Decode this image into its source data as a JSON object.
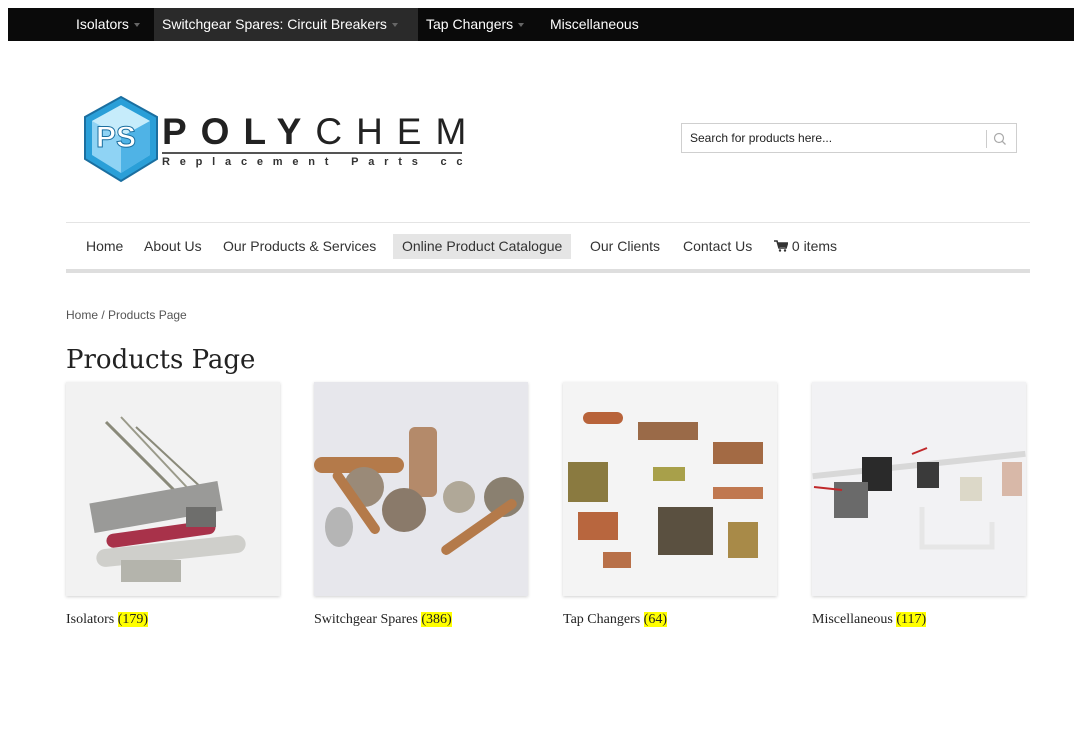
{
  "topbar": {
    "items": [
      {
        "label": "Isolators",
        "has_caret": true
      },
      {
        "label": "Switchgear Spares: Circuit Breakers",
        "has_caret": true
      },
      {
        "label": "Tap Changers",
        "has_caret": true
      },
      {
        "label": "Miscellaneous",
        "has_caret": false
      }
    ]
  },
  "logo": {
    "word_bold": "POLY",
    "word_thin": "CHEM",
    "subtitle": "Replacement Parts cc"
  },
  "search": {
    "placeholder": "Search for products here...",
    "icon": "search-icon"
  },
  "nav": {
    "items": [
      {
        "label": "Home"
      },
      {
        "label": "About Us"
      },
      {
        "label": "Our Products & Services"
      },
      {
        "label": "Online Product Catalogue",
        "active": true
      },
      {
        "label": "Our Clients"
      },
      {
        "label": "Contact Us"
      }
    ],
    "cart": {
      "icon": "cart-icon",
      "label": "0 items"
    }
  },
  "breadcrumb": "Home / Products Page",
  "page_title": "Products Page",
  "products": [
    {
      "name": "Isolators",
      "count": "(179)"
    },
    {
      "name": "Switchgear Spares",
      "count": "(386)"
    },
    {
      "name": "Tap Changers",
      "count": "(64)"
    },
    {
      "name": "Miscellaneous",
      "count": "(117)"
    }
  ],
  "colors": {
    "topbar_bg": "#0a0a0a",
    "logo_blue": "#2a9fd8",
    "count_highlight": "#ffff00"
  }
}
